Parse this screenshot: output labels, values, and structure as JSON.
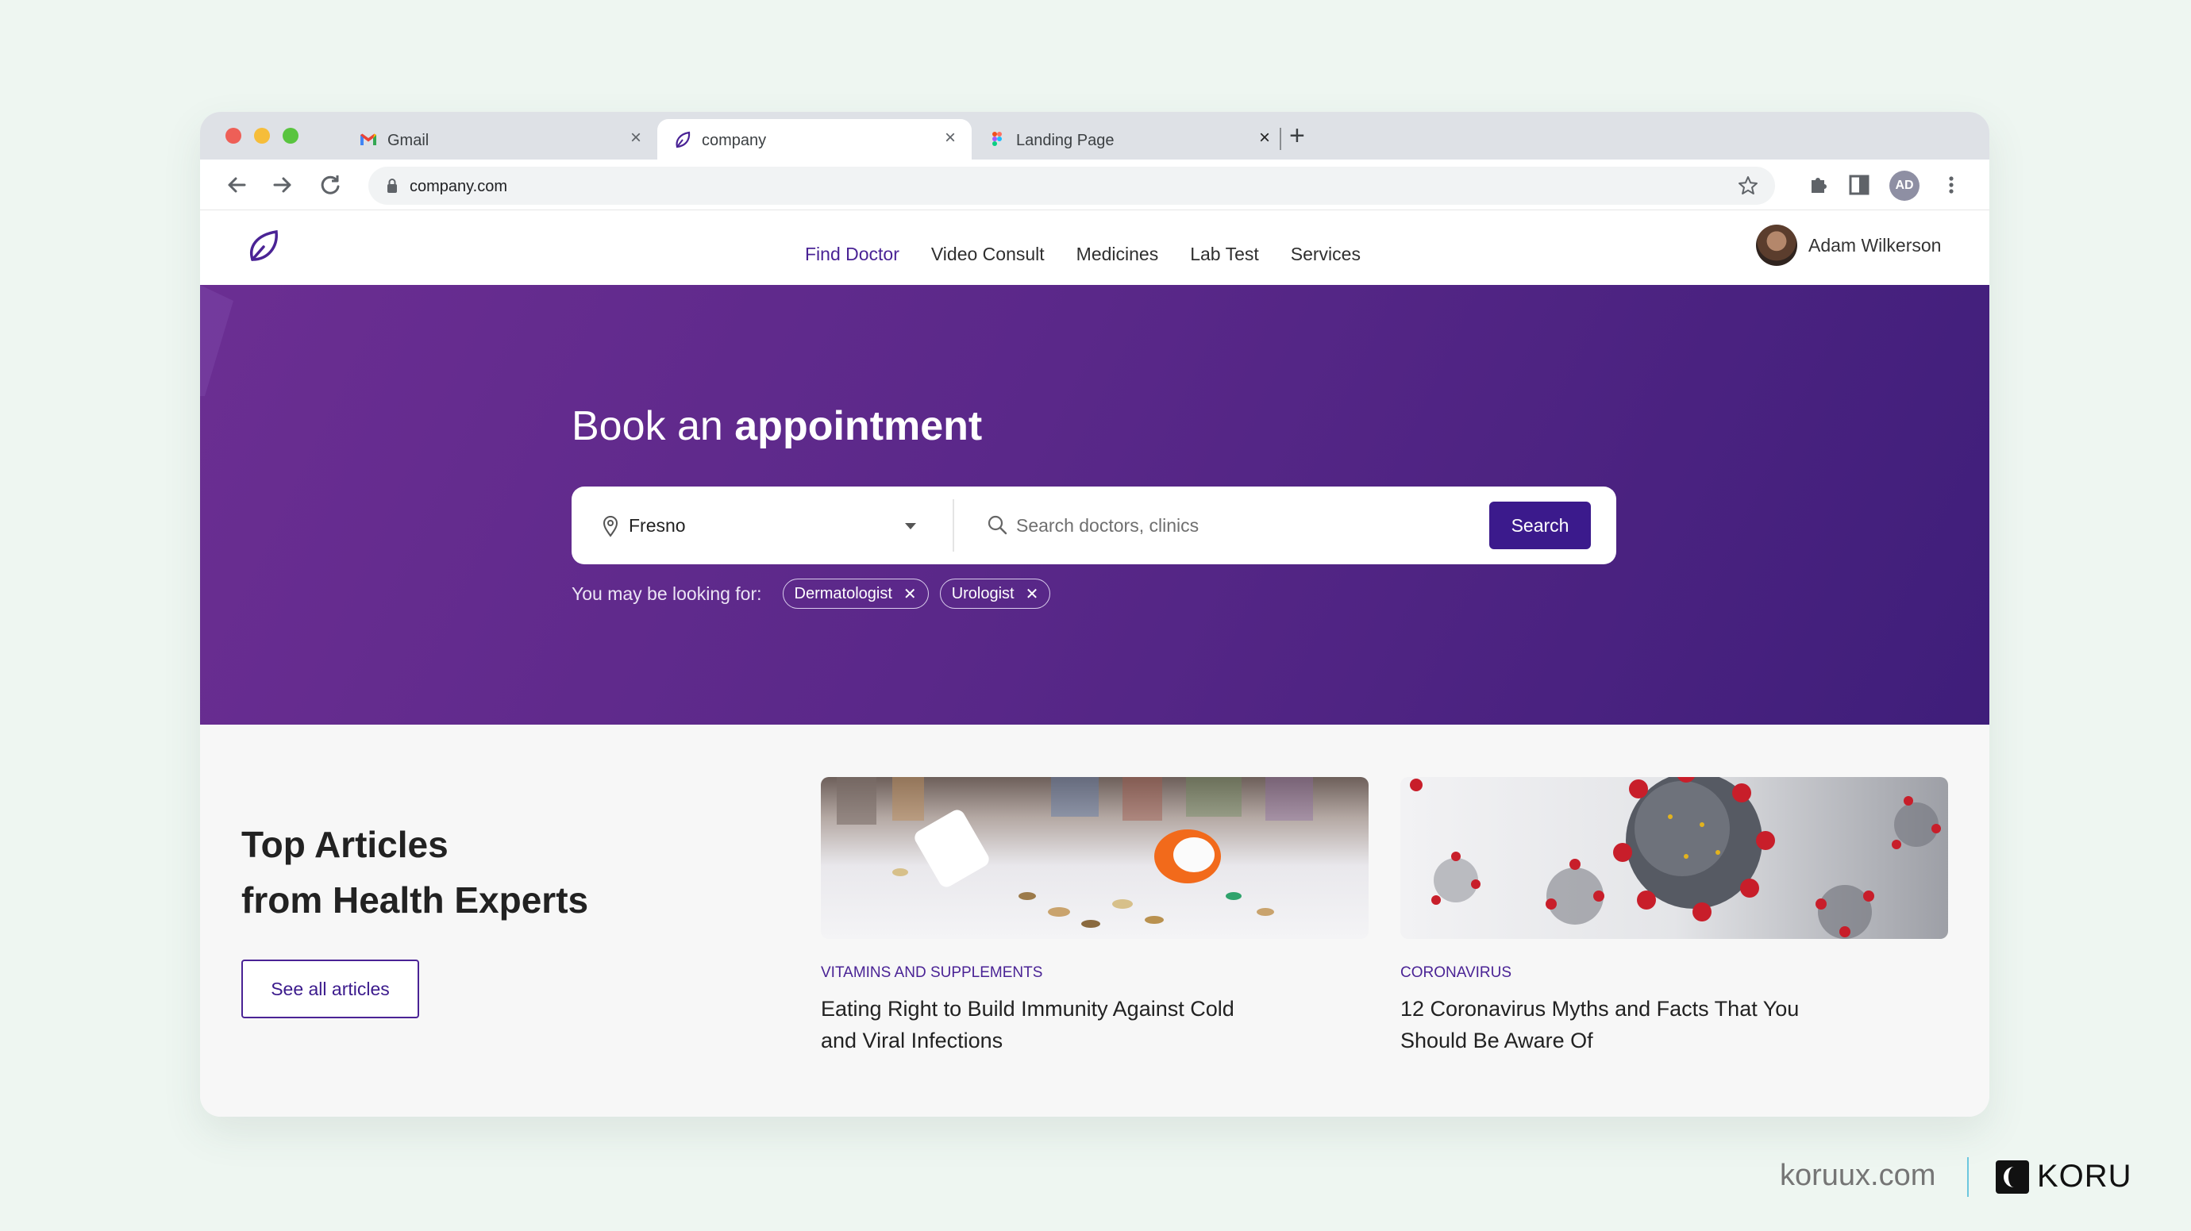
{
  "browser": {
    "tabs": [
      {
        "label": "Gmail",
        "icon": "gmail-icon"
      },
      {
        "label": "company",
        "icon": "leaf-logo-icon"
      },
      {
        "label": "Landing Page",
        "icon": "figma-icon"
      }
    ],
    "active_tab": 1,
    "url": "company.com",
    "profile_initials": "AD"
  },
  "site": {
    "nav": [
      "Find Doctor",
      "Video Consult",
      "Medicines",
      "Lab Test",
      "Services"
    ],
    "active_nav": "Find Doctor",
    "user_name": "Adam Wilkerson",
    "brand_color": "#4a2395"
  },
  "hero": {
    "title_light": "Book an",
    "title_bold": "appointment",
    "location": "Fresno",
    "search_placeholder": "Search doctors, clinics",
    "search_button": "Search",
    "suggest_label": "You may be looking for:",
    "chips": [
      "Dermatologist",
      "Urologist"
    ]
  },
  "articles": {
    "section_title_line1": "Top Articles",
    "section_title_line2": "from Health Experts",
    "see_all": "See all articles",
    "items": [
      {
        "category": "VITAMINS AND SUPPLEMENTS",
        "title": "Eating Right to Build Immunity Against Cold and Viral Infections"
      },
      {
        "category": "CORONAVIRUS",
        "title": "12 Coronavirus Myths and Facts That You Should Be Aware Of"
      }
    ]
  },
  "footer": {
    "url": "koruux.com",
    "brand": "KORU"
  }
}
